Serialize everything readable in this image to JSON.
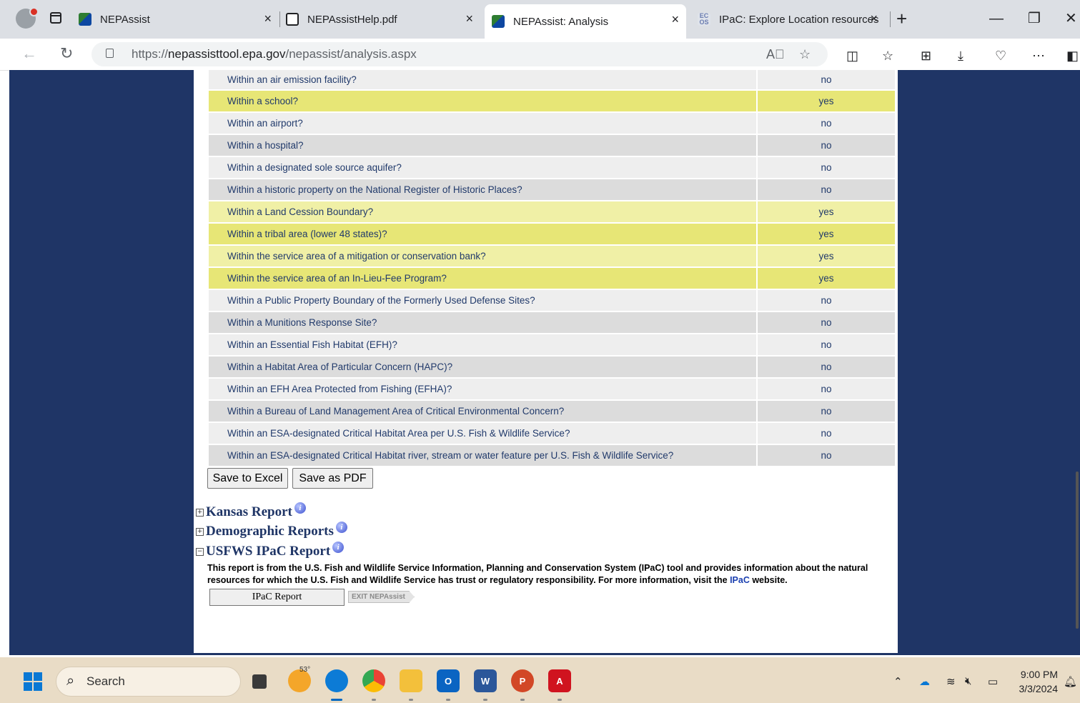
{
  "browser": {
    "tabs": [
      {
        "title": "NEPAssist",
        "active": false
      },
      {
        "title": "NEPAssistHelp.pdf",
        "active": false
      },
      {
        "title": "NEPAssist: Analysis",
        "active": true
      },
      {
        "title": "IPaC: Explore Location resources",
        "active": false
      }
    ],
    "url_prefix": "https://",
    "url_host": "nepassisttool.epa.gov",
    "url_path": "/nepassist/analysis.aspx",
    "close_glyph": "×",
    "newtab_glyph": "+"
  },
  "analysis_table": {
    "rows": [
      {
        "question": "Within an air emission facility?",
        "answer": "no",
        "style": "light"
      },
      {
        "question": "Within a school?",
        "answer": "yes",
        "style": "hl1"
      },
      {
        "question": "Within an airport?",
        "answer": "no",
        "style": "light"
      },
      {
        "question": "Within a hospital?",
        "answer": "no",
        "style": "dark"
      },
      {
        "question": "Within a designated sole source aquifer?",
        "answer": "no",
        "style": "light"
      },
      {
        "question": "Within a historic property on the National Register of Historic Places?",
        "answer": "no",
        "style": "dark"
      },
      {
        "question": "Within a Land Cession Boundary?",
        "answer": "yes",
        "style": "hl2"
      },
      {
        "question": "Within a tribal area (lower 48 states)?",
        "answer": "yes",
        "style": "hl1"
      },
      {
        "question": "Within the service area of a mitigation or conservation bank?",
        "answer": "yes",
        "style": "hl2"
      },
      {
        "question": "Within the service area of an In-Lieu-Fee Program?",
        "answer": "yes",
        "style": "hl1"
      },
      {
        "question": "Within a Public Property Boundary of the Formerly Used Defense Sites?",
        "answer": "no",
        "style": "light"
      },
      {
        "question": "Within a Munitions Response Site?",
        "answer": "no",
        "style": "dark"
      },
      {
        "question": "Within an Essential Fish Habitat (EFH)?",
        "answer": "no",
        "style": "light"
      },
      {
        "question": "Within a Habitat Area of Particular Concern (HAPC)?",
        "answer": "no",
        "style": "dark"
      },
      {
        "question": "Within an EFH Area Protected from Fishing (EFHA)?",
        "answer": "no",
        "style": "light"
      },
      {
        "question": "Within a Bureau of Land Management Area of Critical Environmental Concern?",
        "answer": "no",
        "style": "dark"
      },
      {
        "question": "Within an ESA-designated Critical Habitat Area per U.S. Fish & Wildlife Service?",
        "answer": "no",
        "style": "light"
      },
      {
        "question": "Within an ESA-designated Critical Habitat river, stream or water feature per U.S. Fish & Wildlife Service?",
        "answer": "no",
        "style": "dark"
      }
    ],
    "highlight_colors": {
      "hl1": "#e7e676",
      "hl2": "#f0f0a6"
    }
  },
  "actions": {
    "save_excel": "Save to Excel",
    "save_pdf": "Save as PDF"
  },
  "reports": [
    {
      "title": "Kansas Report",
      "expanded": false,
      "expander": "+"
    },
    {
      "title": "Demographic Reports",
      "expanded": false,
      "expander": "+"
    },
    {
      "title": "USFWS IPaC Report",
      "expanded": true,
      "expander": "−"
    }
  ],
  "ipac": {
    "desc_before": "This report is from the U.S. Fish and Wildlife Service Information, Planning and Conservation System (IPaC) tool and provides information about the natural resources for which the U.S. Fish and Wildlife Service has trust or regulatory responsibility. For more information, visit the ",
    "desc_link": "IPaC",
    "desc_after": " website.",
    "button": "IPaC Report",
    "exit_badge": "EXIT NEPAssist"
  },
  "taskbar": {
    "search_placeholder": "Search",
    "weather_temp": "53°",
    "time": "9:00 PM",
    "date": "3/3/2024"
  },
  "colors": {
    "page_background": "#1f3566",
    "link_text": "#213a6b",
    "accent": "#0a78d4"
  }
}
